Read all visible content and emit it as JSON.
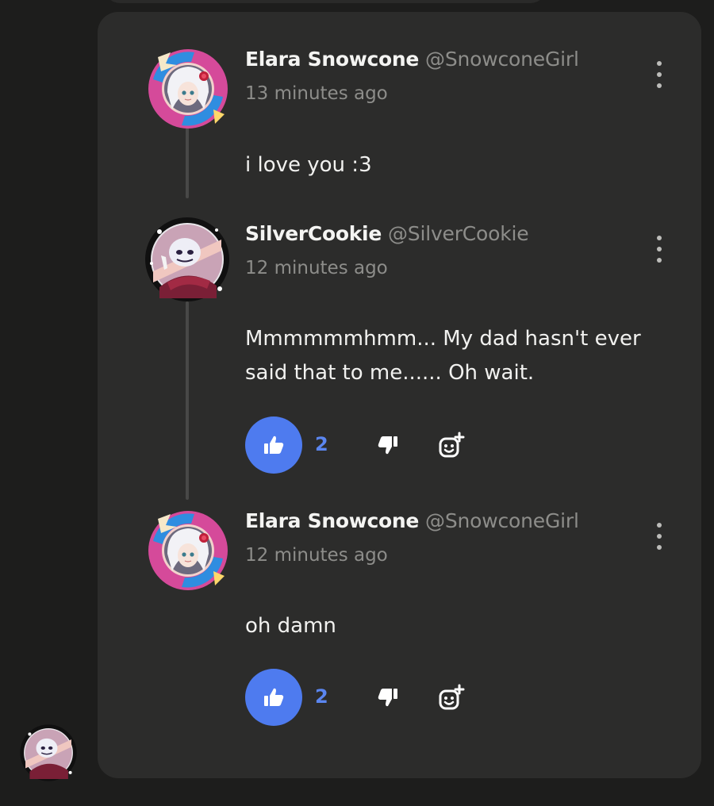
{
  "colors": {
    "background": "#1d1d1c",
    "card": "#2c2c2b",
    "accent": "#4e7bef",
    "like_count": "#5b86f0",
    "muted_text": "#8d8d8a"
  },
  "comments": [
    {
      "author": "Elara Snowcone",
      "handle": "@SnowconeGirl",
      "time": "13 minutes ago",
      "body": "i love you :3",
      "avatar_icon": "white-haired-anime-girl-avatar"
    },
    {
      "author": "SilverCookie",
      "handle": "@SilverCookie",
      "time": "12 minutes ago",
      "body": "Mmmmmmhmm... My dad hasn't ever said that to me...... Oh wait.",
      "likes": "2",
      "avatar_icon": "skeleton-character-avatar"
    },
    {
      "author": "Elara Snowcone",
      "handle": "@SnowconeGirl",
      "time": "12 minutes ago",
      "body": "oh damn",
      "likes": "2",
      "avatar_icon": "white-haired-anime-girl-avatar"
    }
  ],
  "icons": {
    "like": "thumbs-up-icon",
    "dislike": "thumbs-down-icon",
    "react": "add-reaction-icon",
    "more": "more-options-icon",
    "current_user": "current-user-avatar"
  }
}
